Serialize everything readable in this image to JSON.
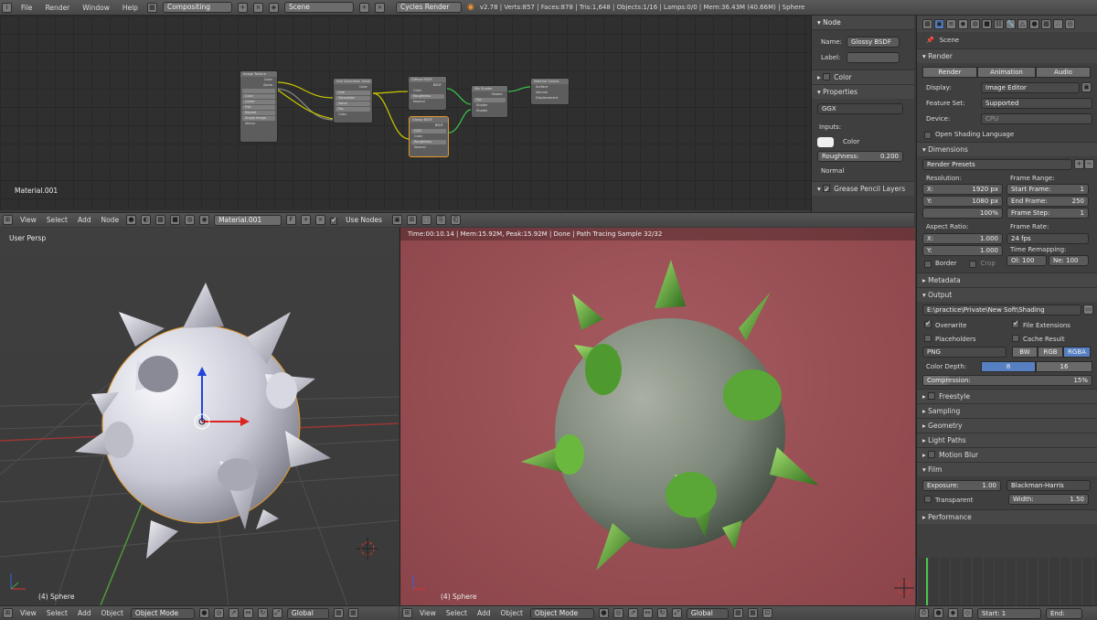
{
  "topbar": {
    "menus": [
      "File",
      "Render",
      "Window",
      "Help"
    ],
    "screen_layout": "Compositing",
    "scene": "Scene",
    "engine": "Cycles Render",
    "stats": "v2.78 | Verts:857 | Faces:878 | Tris:1,648 | Objects:1/16 | Lamps:0/0 | Mem:36.43M (40.66M) | Sphere"
  },
  "node_editor": {
    "material_label": "Material.001",
    "header": {
      "menus": [
        "View",
        "Select",
        "Add",
        "Node"
      ],
      "material": "Material.001",
      "fake_user": "F",
      "use_nodes_label": "Use Nodes"
    },
    "nodes": [
      {
        "title": "Image Texture",
        "rows": [
          "Color",
          "Alpha",
          "",
          "Color",
          "Linear",
          "Flat",
          "Repeat",
          "Single Image",
          "Vector"
        ]
      },
      {
        "title": "Hue Saturation Value",
        "rows": [
          "Color",
          "Hue",
          "Saturation",
          "Value",
          "Fac",
          "Color"
        ]
      },
      {
        "title": "Diffuse BSDF",
        "rows": [
          "BSDF",
          "Color",
          "Roughness",
          "Normal"
        ]
      },
      {
        "title": "Glossy BSDF",
        "rows": [
          "BSDF",
          "GGX",
          "Color",
          "Roughness",
          "Normal"
        ]
      },
      {
        "title": "Mix Shader",
        "rows": [
          "Shader",
          "Fac",
          "Shader",
          "Shader"
        ]
      },
      {
        "title": "Material Output",
        "rows": [
          "Surface",
          "Volume",
          "Displacement"
        ]
      }
    ]
  },
  "node_panel": {
    "node_header": "Node",
    "name_label": "Name:",
    "name_value": "Glossy BSDF",
    "label_label": "Label:",
    "color_header": "Color",
    "properties_header": "Properties",
    "distribution": "GGX",
    "inputs_label": "Inputs:",
    "color_input_label": "Color",
    "roughness_label": "Roughness:",
    "roughness_value": "0.200",
    "normal_label": "Normal",
    "grease_pencil_header": "Grease Pencil Layers"
  },
  "viewport": {
    "view_label": "User Persp",
    "object_label": "(4) Sphere",
    "header": {
      "menus": [
        "View",
        "Select",
        "Add",
        "Object"
      ],
      "mode": "Object Mode",
      "orientation": "Global"
    }
  },
  "render_view": {
    "status": "Time:00:10.14 | Mem:15.92M, Peak:15.92M | Done | Path Tracing Sample 32/32",
    "object_label": "(4) Sphere",
    "header": {
      "menus": [
        "View",
        "Select",
        "Add",
        "Object"
      ],
      "mode": "Object Mode",
      "orientation": "Global"
    }
  },
  "properties": {
    "scene_label": "Scene",
    "render_header": "Render",
    "render_buttons": [
      "Render",
      "Animation",
      "Audio"
    ],
    "display_label": "Display:",
    "display_value": "Image Editor",
    "feature_set_label": "Feature Set:",
    "feature_set_value": "Supported",
    "device_label": "Device:",
    "device_value": "CPU",
    "osl_label": "Open Shading Language",
    "dimensions_header": "Dimensions",
    "render_presets": "Render Presets",
    "resolution_label": "Resolution:",
    "res_x": "X:",
    "res_x_value": "1920 px",
    "res_y": "Y:",
    "res_y_value": "1080 px",
    "res_percent": "100%",
    "frame_range_label": "Frame Range:",
    "start_frame": "Start Frame:",
    "start_frame_value": "1",
    "end_frame": "End Frame:",
    "end_frame_value": "250",
    "frame_step": "Frame Step:",
    "frame_step_value": "1",
    "aspect_label": "Aspect Ratio:",
    "aspect_x": "X:",
    "aspect_x_value": "1.000",
    "aspect_y": "Y:",
    "aspect_y_value": "1.000",
    "frame_rate_label": "Frame Rate:",
    "frame_rate_value": "24 fps",
    "time_remap_label": "Time Remapping:",
    "old": "Ol:",
    "old_value": "100",
    "new": "Ne:",
    "new_value": "100",
    "border_label": "Border",
    "crop_label": "Crop",
    "metadata_header": "Metadata",
    "output_header": "Output",
    "output_path": "E:\\practice\\Private\\New Soft\\Shading",
    "overwrite_label": "Overwrite",
    "file_ext_label": "File Extensions",
    "placeholders_label": "Placeholders",
    "cache_label": "Cache Result",
    "format": "PNG",
    "color_modes": [
      "BW",
      "RGB",
      "RGBA"
    ],
    "color_depth_label": "Color Depth:",
    "depths": [
      "8",
      "16"
    ],
    "compression_label": "Compression:",
    "compression_value": "15%",
    "freestyle_header": "Freestyle",
    "sampling_header": "Sampling",
    "geometry_header": "Geometry",
    "light_paths_header": "Light Paths",
    "motion_blur_header": "Motion Blur",
    "film_header": "Film",
    "exposure_label": "Exposure:",
    "exposure_value": "1.00",
    "filter": "Blackman-Harris",
    "transparent_label": "Transparent",
    "width_label": "Width:",
    "width_value": "1.50",
    "performance_header": "Performance"
  },
  "timeline": {
    "start_label": "Start:",
    "start_value": "1",
    "end_label": "End:"
  },
  "colors": {
    "accent_blue": "#5680c2",
    "render_bg": "#9a5155",
    "spike_green": "#4aa12c"
  }
}
